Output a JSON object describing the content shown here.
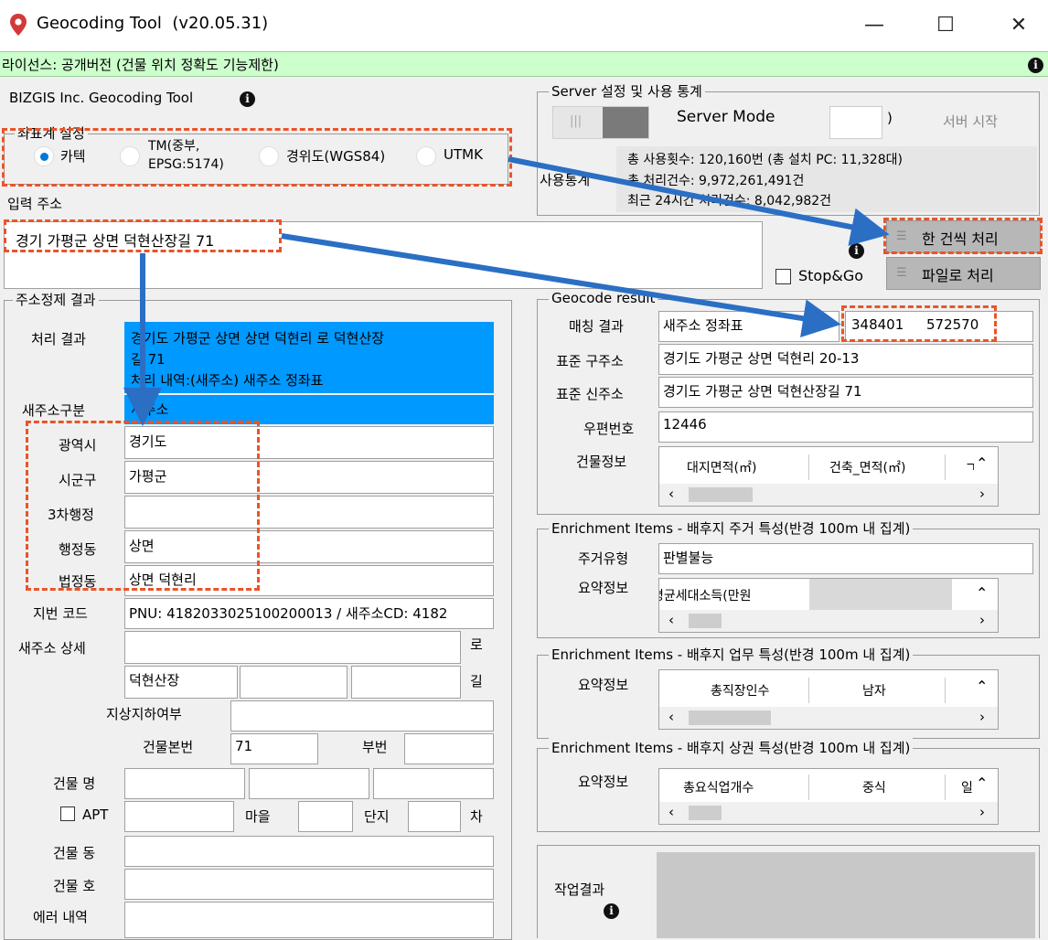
{
  "window": {
    "title": "Geocoding Tool  (v20.05.31)",
    "minimize": "—",
    "maximize": "☐",
    "close": "✕"
  },
  "license": {
    "text": "라이선스: 공개버전 (건물 위치 정확도 기능제한)"
  },
  "brand": {
    "text": "BIZGIS Inc. Geocoding Tool"
  },
  "coord_system": {
    "legend": "좌표계 설정",
    "options": [
      "카텍",
      "TM(중부,\nEPSG:5174)",
      "경위도(WGS84)",
      "UTMK"
    ],
    "selected": "카텍"
  },
  "input": {
    "label": "입력 주소",
    "value": "경기 가평군 상면 덕현산장길 71",
    "stopgo": "Stop&Go",
    "btn_single": "한 건씩 처리",
    "btn_file": "파일로 처리"
  },
  "server": {
    "legend": "Server 설정 및 사용 통계",
    "mode_label": "Server Mode",
    "paren": ")",
    "start": "서버 시작",
    "stats_label": "사용통계",
    "stats": [
      "총 사용횟수: 120,160번 (총 설치 PC: 11,328대)",
      "총 처리건수: 9,972,261,491건",
      "최근 24시간 처리건수: 8,042,982건"
    ]
  },
  "refine": {
    "legend": "주소정제 결과",
    "result_label": "처리 결과",
    "result_lines": [
      "경기도 가평군 상면 상면 덕현리 로 덕현산장",
      "길 71",
      "처리 내역:(새주소) 새주소 정좌표"
    ],
    "newaddr_type_label": "새주소구분",
    "newaddr_type": "새주소",
    "sido_label": "광역시",
    "sido": "경기도",
    "sigungu_label": "시군구",
    "sigungu": "가평군",
    "third_label": "3차행정",
    "third": "",
    "admdong_label": "행정동",
    "admdong": "상면",
    "legaldong_label": "법정동",
    "legaldong": "상면 덕현리",
    "jibun_label": "지번 코드",
    "jibun": "PNU: 4182033025100200013 / 새주소CD: 4182",
    "detail_label": "새주소 상세",
    "ro": "로",
    "road": "덕현산장",
    "gil": "길",
    "underground_label": "지상지하여부",
    "bldg_main_label": "건물본번",
    "bldg_main": "71",
    "bldg_sub_label": "부번",
    "bldg_name_label": "건물 명",
    "apt_label": "APT",
    "village_label": "마을",
    "complex_label": "단지",
    "cha_label": "차",
    "bldg_dong_label": "건물 동",
    "bldg_ho_label": "건물 호",
    "error_label": "에러 내역"
  },
  "geocode": {
    "legend": "Geocode result",
    "match_label": "매칭 결과",
    "match": "새주소 정좌표",
    "x": "348401",
    "y": "572570",
    "old_label": "표준 구주소",
    "old": "경기도 가평군 상면 덕현리 20-13",
    "new_label": "표준 신주소",
    "new": "경기도 가평군 상면 덕현산장길 71",
    "zip_label": "우편번호",
    "zip": "12446",
    "bldg_label": "건물정보",
    "bldg_cols": [
      "대지면적(㎡)",
      "건축_면적(㎡)",
      "ㄱ"
    ]
  },
  "enrich_res": {
    "legend": "Enrichment Items - 배후지 주거 특성(반경 100m 내 집계)",
    "type_label": "주거유형",
    "type": "판별불능",
    "summary_label": "요약정보",
    "cols": [
      "평균세대소득(만원"
    ]
  },
  "enrich_biz": {
    "legend": "Enrichment Items - 배후지 업무 특성(반경 100m 내 집계)",
    "summary_label": "요약정보",
    "cols": [
      "총직장인수",
      "남자"
    ]
  },
  "enrich_com": {
    "legend": "Enrichment Items - 배후지 상권 특성(반경 100m 내 집계)",
    "summary_label": "요약정보",
    "cols": [
      "총요식업개수",
      "중식",
      "일"
    ]
  },
  "work": {
    "label": "작업결과"
  },
  "colors": {
    "accent": "#0099ff",
    "license_bg": "#ccffcc",
    "annotation": "#e8552a",
    "arrow": "#2a6fc4"
  },
  "icons": [
    "map-pin-icon",
    "info-icon",
    "list-icon",
    "chevron-up-down-icon",
    "chevron-left-icon",
    "chevron-right-icon"
  ]
}
